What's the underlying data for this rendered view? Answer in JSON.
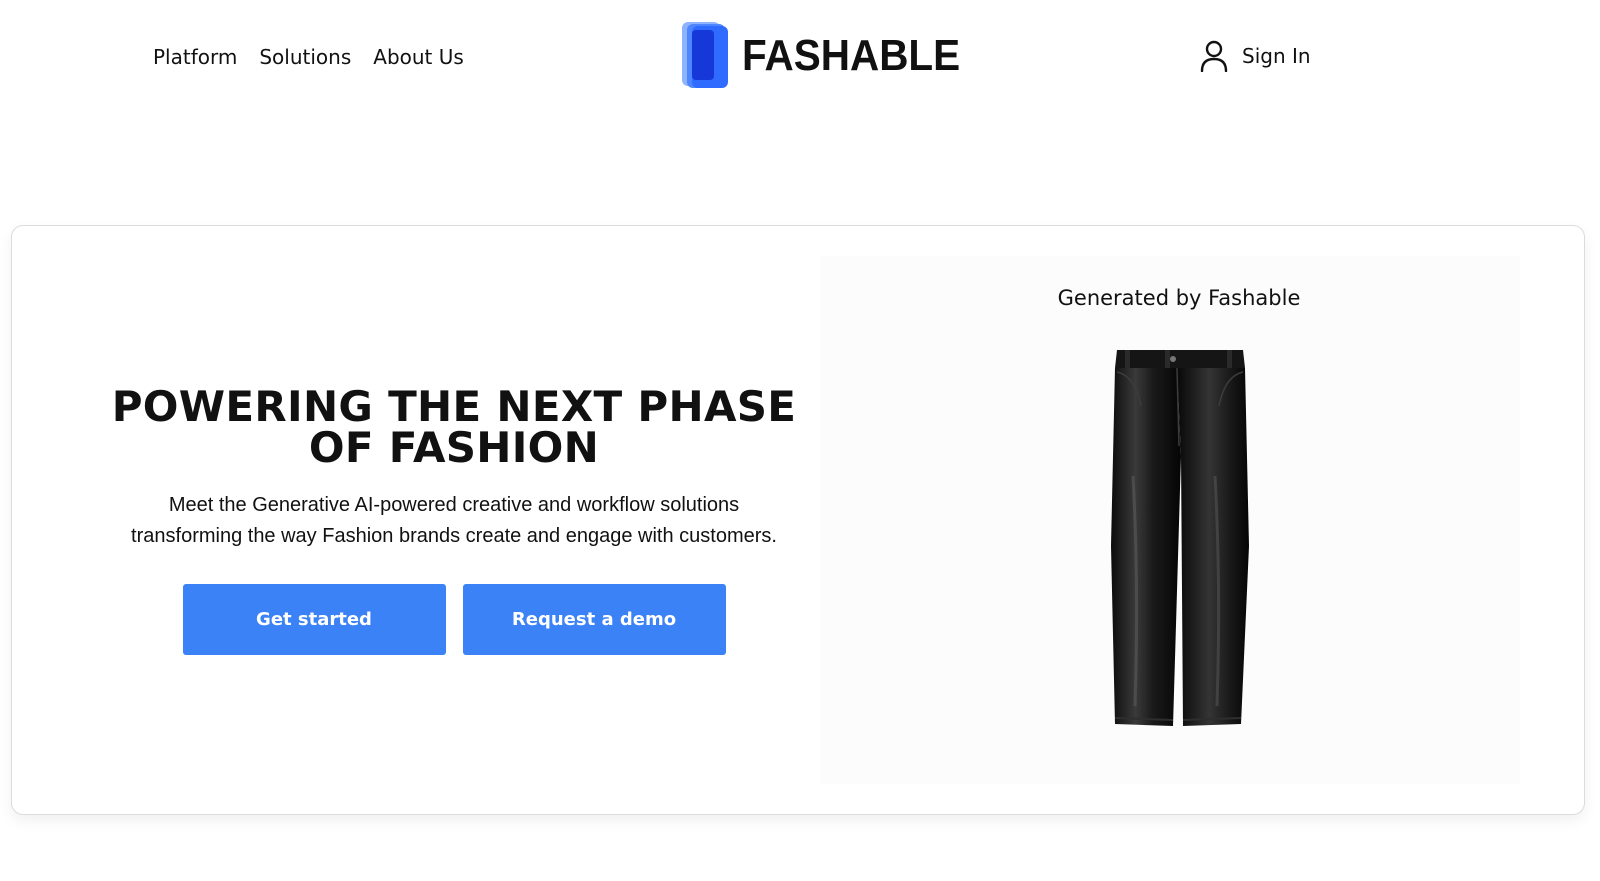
{
  "nav": {
    "items": [
      {
        "label": "Platform"
      },
      {
        "label": "Solutions"
      },
      {
        "label": "About Us"
      }
    ]
  },
  "logo": {
    "text": "FASHABLE",
    "icon": "layered-card-logo-icon",
    "colors": [
      "#8fb4ff",
      "#4d86ff",
      "#2f6bff",
      "#1638d9"
    ]
  },
  "signin": {
    "label": "Sign In",
    "icon": "user-icon"
  },
  "hero": {
    "title_line1": "POWERING THE NEXT PHASE",
    "title_line2": "OF FASHION",
    "description_line1": "Meet the Generative AI-powered creative and workflow solutions",
    "description_line2": "transforming the way Fashion brands create and engage with customers.",
    "primary_button": "Get started",
    "secondary_button": "Request a demo",
    "button_color": "#3b82f6"
  },
  "showcase": {
    "label": "Generated by Fashable",
    "image": "black-leather-pants-image"
  }
}
